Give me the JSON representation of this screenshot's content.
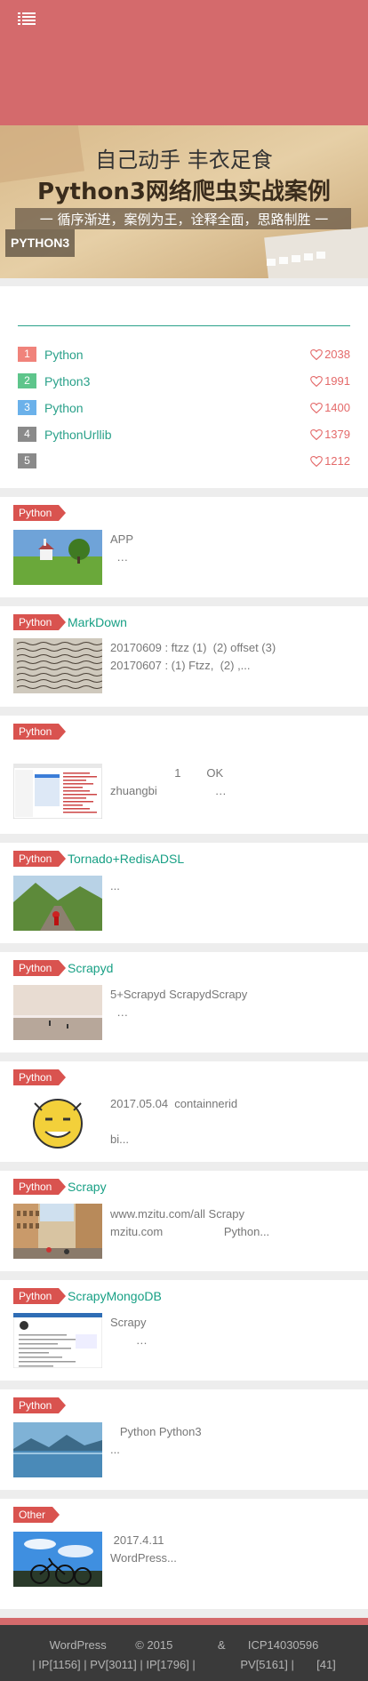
{
  "banner": {
    "line1": "自己动手  丰衣足食",
    "line2": "Python3网络爬虫实战案例",
    "line3": "一 循序渐进，案例为王，诠释全面，思路制胜 一",
    "tag": "PYTHON3"
  },
  "hot": {
    "title": "",
    "items": [
      {
        "rank": "1",
        "name": "Python",
        "likes": "2038",
        "color": "#f0837b"
      },
      {
        "rank": "2",
        "name": "Python3",
        "likes": "1991",
        "color": "#5ec58b"
      },
      {
        "rank": "3",
        "name": "Python",
        "likes": "1400",
        "color": "#6bb1ea"
      },
      {
        "rank": "4",
        "name": "PythonUrllib",
        "likes": "1379",
        "color": "#8a8a8a"
      },
      {
        "rank": "5",
        "name": "",
        "likes": "1212",
        "color": "#8a8a8a"
      }
    ]
  },
  "posts": [
    {
      "category": "Python",
      "title": "",
      "excerpt": "APP\n  …",
      "thumb": "landscape-chapel"
    },
    {
      "category": "Python",
      "title": "MarkDown",
      "excerpt": "20170609 : ftzz (1)  (2) offset (3)\n20170607 : (1) Ftzz,  (2) ,...",
      "thumb": "handwriting"
    },
    {
      "category": "Python",
      "title": " ",
      "excerpt": "                    1        OK\nzhuangbi                  …",
      "thumb": "code-screenshot"
    },
    {
      "category": "Python",
      "title": "Tornado+RedisADSL",
      "excerpt": "...",
      "thumb": "mountain-road"
    },
    {
      "category": "Python",
      "title": "Scrapyd",
      "excerpt": "5+Scrapyd ScrapydScrapy\n  …",
      "thumb": "beach-sunset"
    },
    {
      "category": "Python",
      "title": " ",
      "excerpt": "2017.05.04  containnerid\n\nbi...",
      "thumb": "emoji-face"
    },
    {
      "category": "Python",
      "title": "Scrapy",
      "excerpt": "www.mzitu.com/all Scrapy\nmzitu.com                   Python...",
      "thumb": "city-street"
    },
    {
      "category": "Python",
      "title": "ScrapyMongoDB",
      "excerpt": "Scrapy\n        …",
      "thumb": "web-screenshot"
    },
    {
      "category": "Python",
      "title": "",
      "excerpt": "   Python Python3\n...",
      "thumb": "lake"
    },
    {
      "category": "Other",
      "title": "",
      "excerpt": " 2017.4.11\nWordPress...",
      "thumb": "bicycles"
    }
  ],
  "footer": {
    "line1": "WordPress         © 2015              &       ICP14030596",
    "line2": "| IP[1156] | PV[3011] | IP[1796] |              PV[5161] |       [41]"
  },
  "colors": {
    "header": "#d46a6c",
    "accent": "#2aa18a",
    "category": "#d9534f"
  },
  "icons": {
    "menu": "menu-icon",
    "like": "heart-icon"
  }
}
